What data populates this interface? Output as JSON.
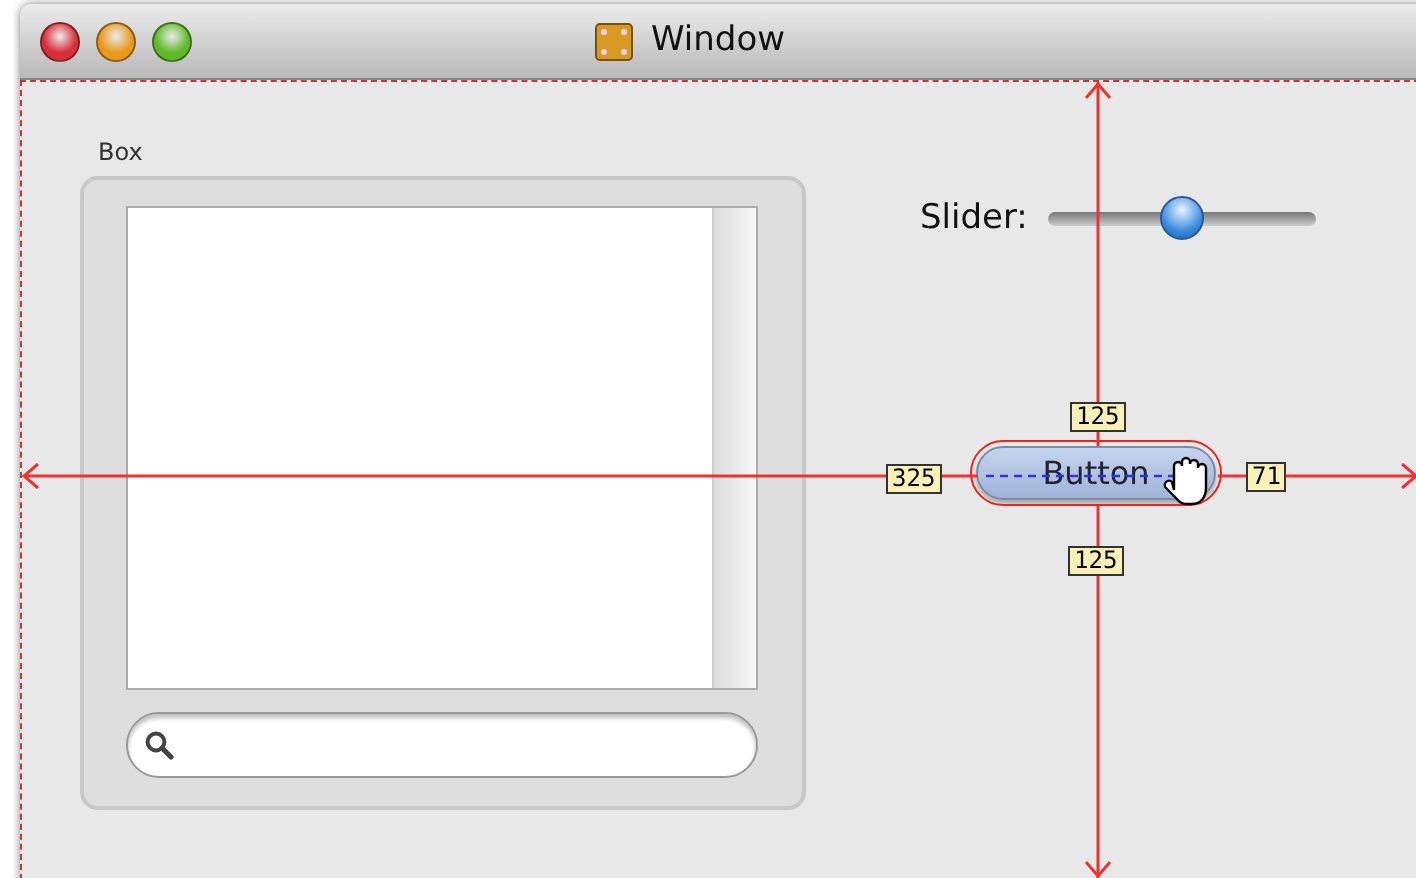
{
  "window": {
    "title": "Window"
  },
  "box": {
    "title": "Box"
  },
  "slider": {
    "label": "Slider:",
    "level": 0.5
  },
  "button": {
    "label": "Button",
    "selected": true
  },
  "distances": [
    {
      "kind": "top",
      "value": "125"
    },
    {
      "kind": "left",
      "value": "325"
    },
    {
      "kind": "right",
      "value": "71"
    },
    {
      "kind": "bottom",
      "value": "125"
    }
  ]
}
